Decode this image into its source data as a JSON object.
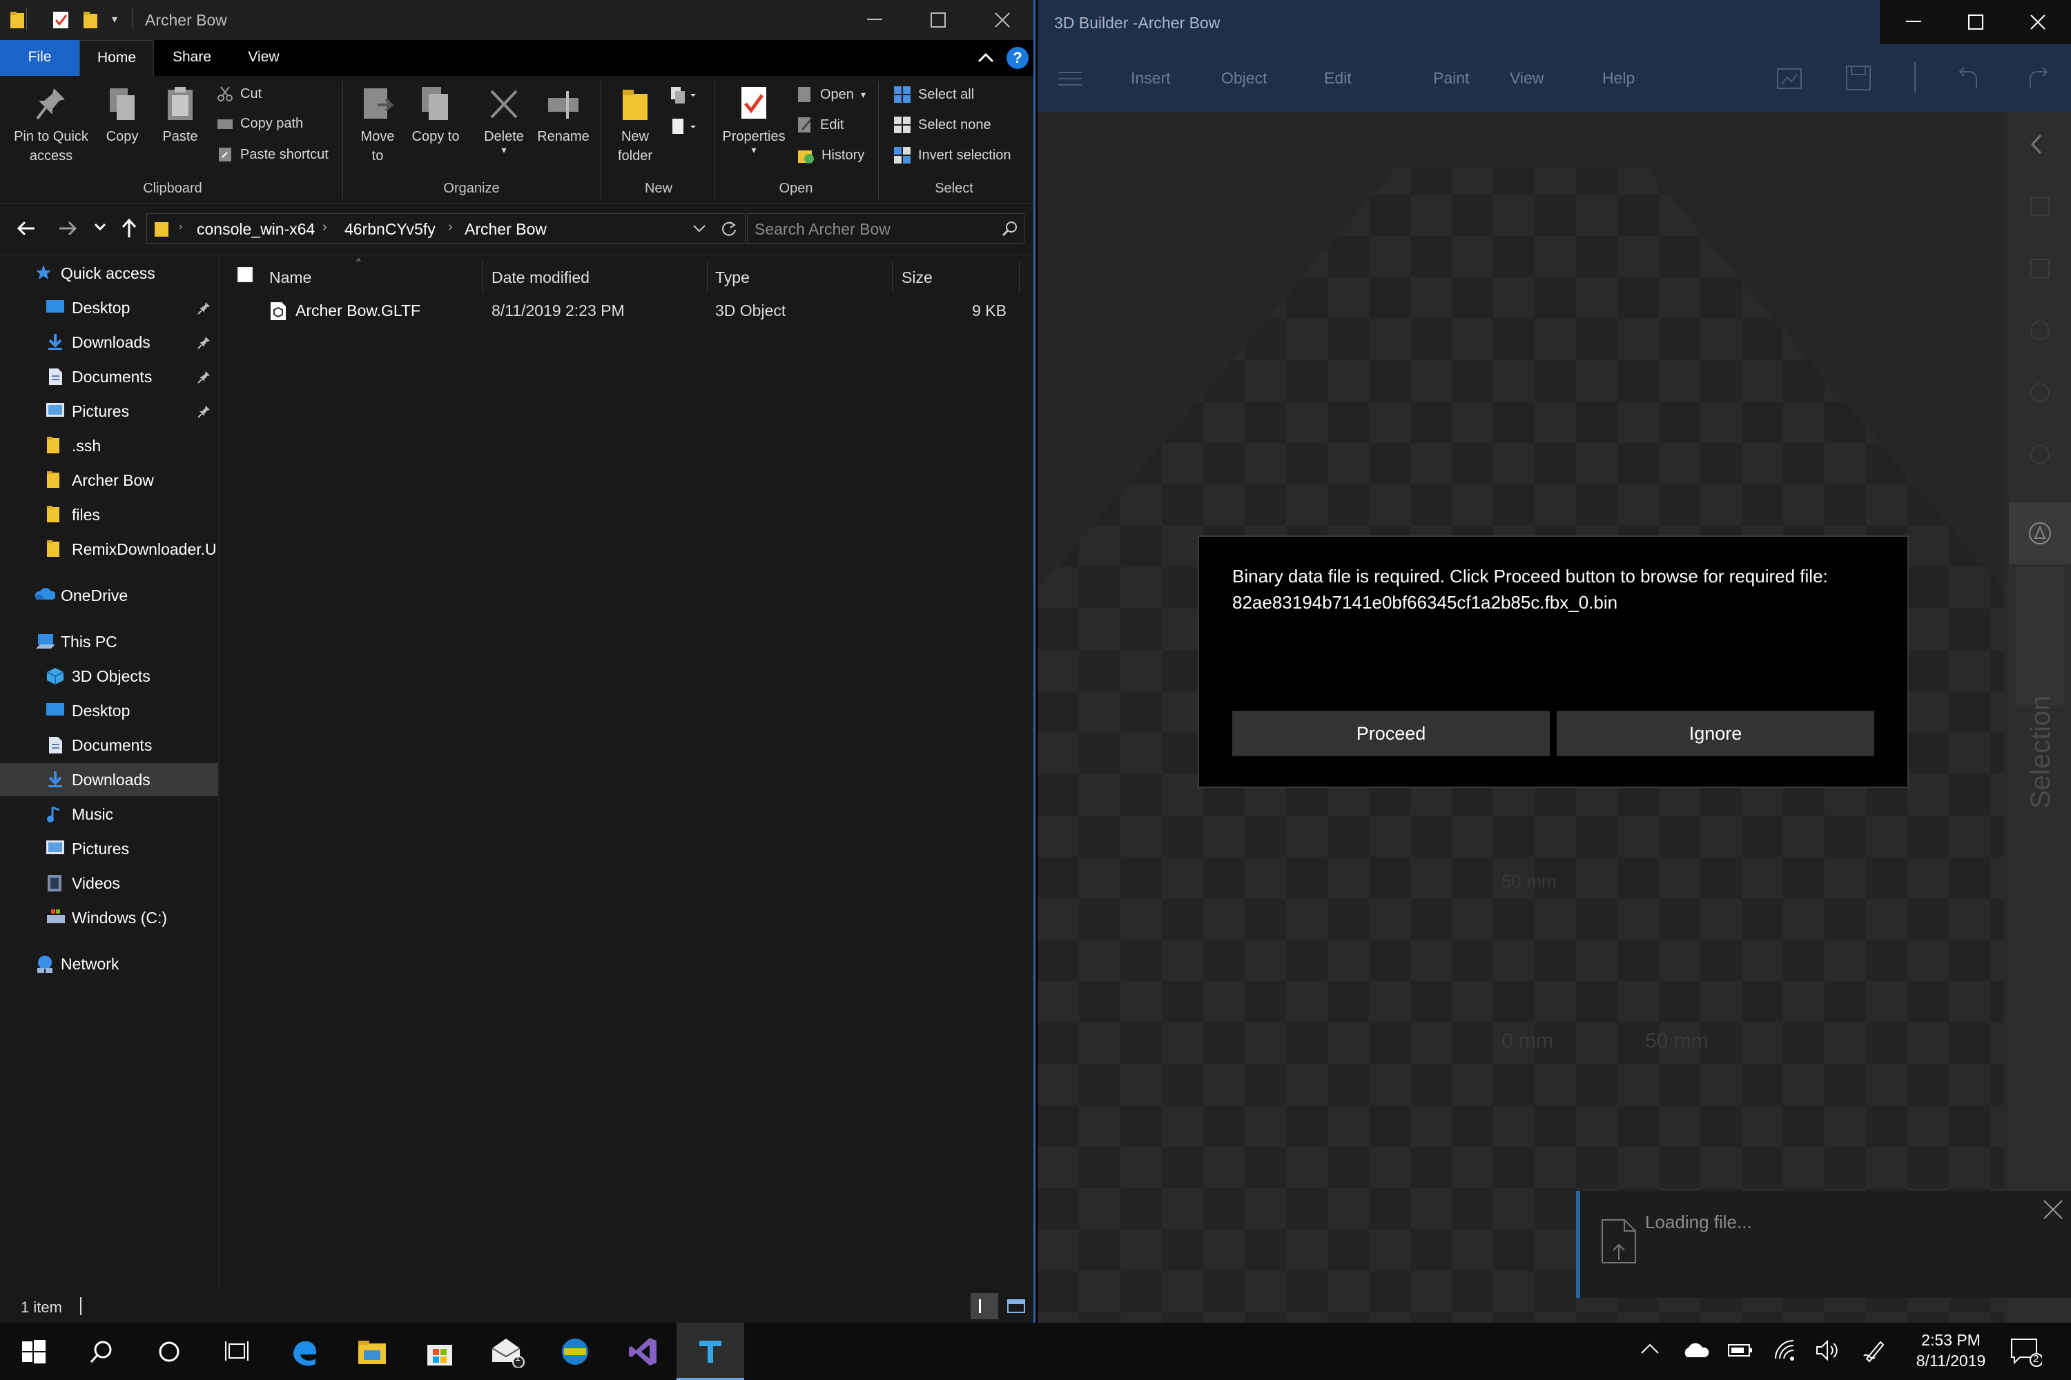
{
  "explorer": {
    "title": "Archer Bow",
    "tabs": [
      "File",
      "Home",
      "Share",
      "View"
    ],
    "ribbon": {
      "pin": "Pin to Quick access",
      "copy": "Copy",
      "paste": "Paste",
      "cut": "Cut",
      "copy_path": "Copy path",
      "paste_shortcut": "Paste shortcut",
      "move_to": "Move to",
      "copy_to": "Copy to",
      "delete": "Delete",
      "rename": "Rename",
      "new_folder": "New folder",
      "properties": "Properties",
      "open": "Open",
      "edit": "Edit",
      "history": "History",
      "select_all": "Select all",
      "select_none": "Select none",
      "invert_selection": "Invert selection",
      "groups": [
        "Clipboard",
        "Organize",
        "New",
        "Open",
        "Select"
      ]
    },
    "address": {
      "crumbs": [
        "console_win-x64",
        "46rbnCYv5fy",
        "Archer Bow"
      ],
      "search_placeholder": "Search Archer Bow"
    },
    "nav": [
      {
        "label": "Quick access",
        "icon": "star-icon",
        "level": 0,
        "pinned": false
      },
      {
        "label": "Desktop",
        "icon": "desktop-icon",
        "level": 1,
        "pinned": true
      },
      {
        "label": "Downloads",
        "icon": "download-icon",
        "level": 1,
        "pinned": true
      },
      {
        "label": "Documents",
        "icon": "document-icon",
        "level": 1,
        "pinned": true
      },
      {
        "label": "Pictures",
        "icon": "pictures-icon",
        "level": 1,
        "pinned": true
      },
      {
        "label": ".ssh",
        "icon": "folder-icon",
        "level": 1,
        "pinned": false
      },
      {
        "label": "Archer Bow",
        "icon": "folder-icon",
        "level": 1,
        "pinned": false
      },
      {
        "label": "files",
        "icon": "folder-icon",
        "level": 1,
        "pinned": false
      },
      {
        "label": "RemixDownloader.U",
        "icon": "folder-icon",
        "level": 1,
        "pinned": false
      },
      {
        "label": "OneDrive",
        "icon": "cloud-icon",
        "level": 0,
        "pinned": false
      },
      {
        "label": "This PC",
        "icon": "computer-icon",
        "level": 0,
        "pinned": false
      },
      {
        "label": "3D Objects",
        "icon": "cube-icon",
        "level": 1,
        "pinned": false
      },
      {
        "label": "Desktop",
        "icon": "desktop-icon",
        "level": 1,
        "pinned": false
      },
      {
        "label": "Documents",
        "icon": "document-icon",
        "level": 1,
        "pinned": false
      },
      {
        "label": "Downloads",
        "icon": "download-icon",
        "level": 1,
        "pinned": false,
        "selected": true
      },
      {
        "label": "Music",
        "icon": "music-icon",
        "level": 1,
        "pinned": false
      },
      {
        "label": "Pictures",
        "icon": "pictures-icon",
        "level": 1,
        "pinned": false
      },
      {
        "label": "Videos",
        "icon": "video-icon",
        "level": 1,
        "pinned": false
      },
      {
        "label": "Windows (C:)",
        "icon": "drive-icon",
        "level": 1,
        "pinned": false
      },
      {
        "label": "Network",
        "icon": "network-icon",
        "level": 0,
        "pinned": false
      }
    ],
    "columns": [
      "Name",
      "Date modified",
      "Type",
      "Size"
    ],
    "files": [
      {
        "name": "Archer Bow.GLTF",
        "date": "8/11/2019 2:23 PM",
        "type": "3D Object",
        "size": "9 KB"
      }
    ],
    "status": "1 item"
  },
  "builder": {
    "title": "3D Builder -Archer Bow",
    "menu": [
      "Insert",
      "Object",
      "Edit",
      "Paint",
      "View",
      "Help"
    ],
    "side_label": "Selection",
    "grid_labels": [
      "50 mm",
      "0 mm",
      "50 mm"
    ],
    "dialog": {
      "message": "Binary data file is required. Click Proceed button to browse for required file:",
      "filename": "82ae83194b7141e0bf66345cf1a2b85c.fbx_0.bin",
      "proceed": "Proceed",
      "ignore": "Ignore"
    },
    "loading": "Loading file..."
  },
  "taskbar": {
    "time": "2:53 PM",
    "date": "8/11/2019",
    "mail_badge": "1",
    "notif_badge": "2"
  },
  "colors": {
    "accent": "#1a63c7",
    "builder_header": "#1f2f4a",
    "folder": "#f0c430"
  }
}
